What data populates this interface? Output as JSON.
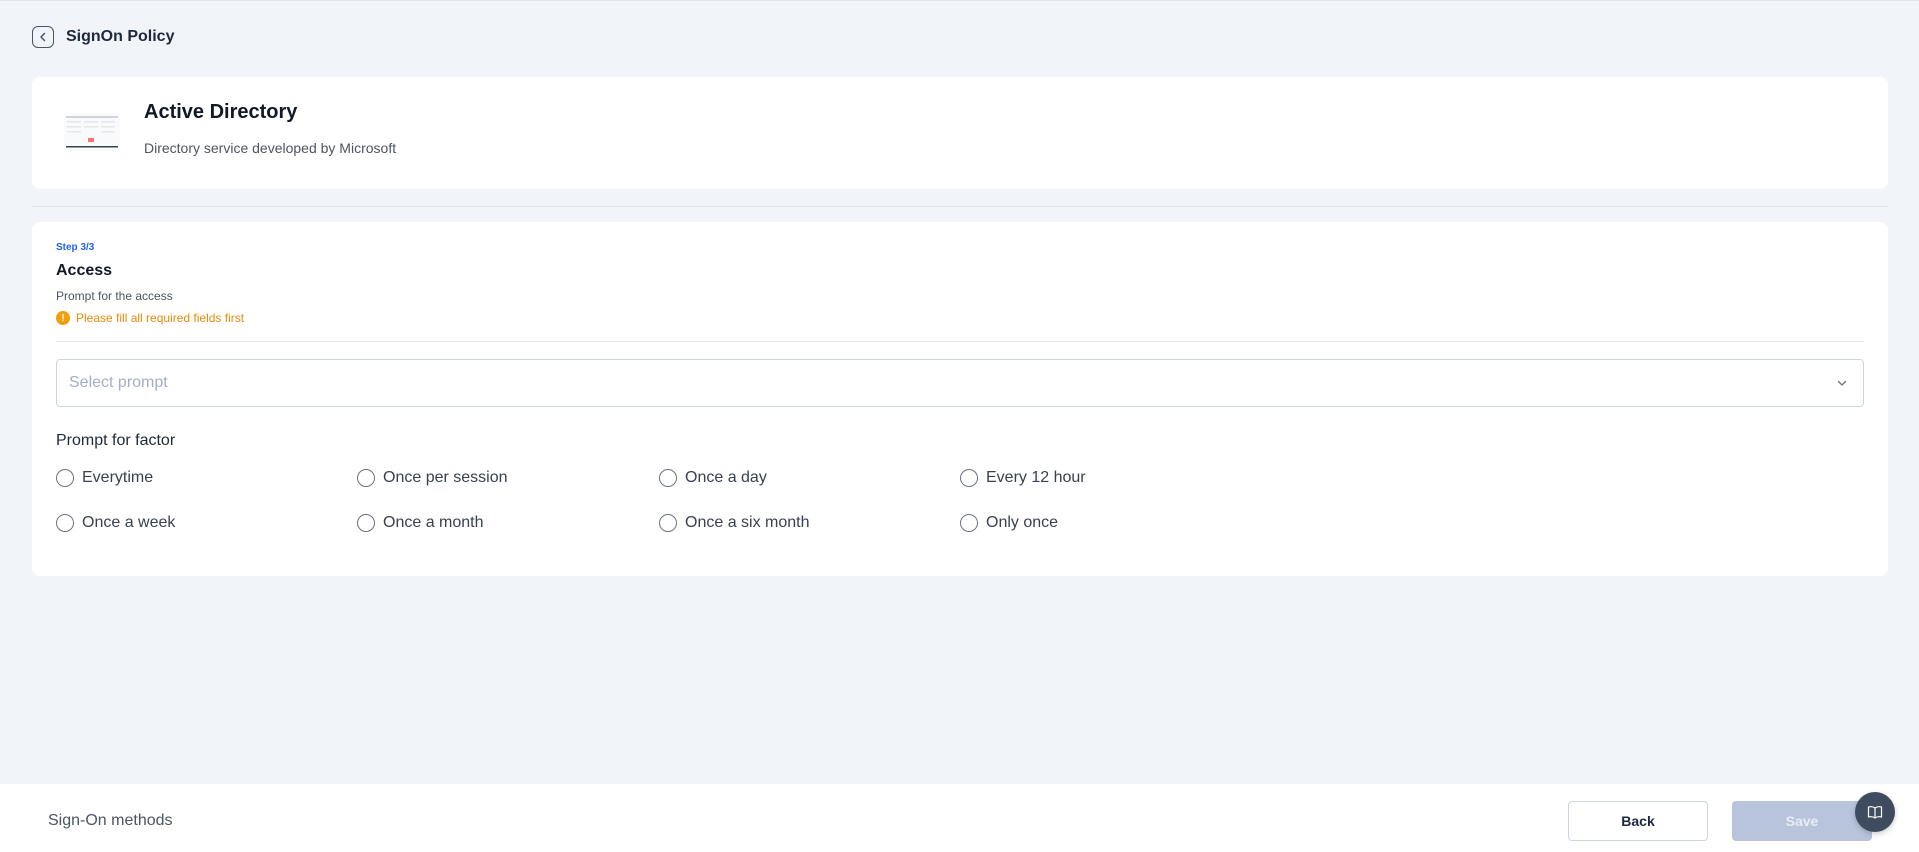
{
  "header": {
    "title": "SignOn Policy"
  },
  "app": {
    "name": "Active Directory",
    "description": "Directory service developed by Microsoft"
  },
  "step": {
    "label": "Step 3/3",
    "title": "Access",
    "description": "Prompt for the access",
    "warning": "Please fill all required fields first"
  },
  "prompt_select": {
    "placeholder": "Select prompt"
  },
  "factor": {
    "title": "Prompt for factor",
    "options": [
      "Everytime",
      "Once per session",
      "Once a day",
      "Every 12 hour",
      "Once a week",
      "Once a month",
      "Once a six month",
      "Only once"
    ]
  },
  "footer": {
    "label": "Sign-On methods",
    "back_label": "Back",
    "save_label": "Save"
  },
  "colors": {
    "accent": "#2563eb",
    "warning": "#f59e0b",
    "save_disabled": "#b8c4dc"
  }
}
